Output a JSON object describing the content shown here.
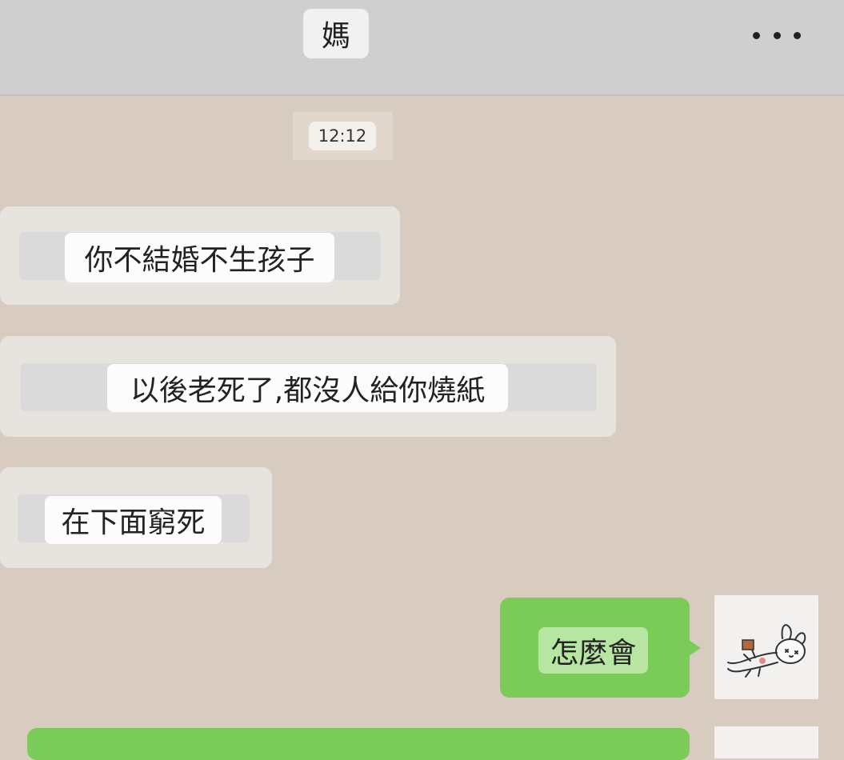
{
  "header": {
    "title": "媽",
    "more_icon": "more-dots-icon"
  },
  "timestamp": "12:12",
  "messages": [
    {
      "side": "incoming",
      "text": "你不結婚不生孩子"
    },
    {
      "side": "incoming",
      "text": "以後老死了,都沒人給你燒紙"
    },
    {
      "side": "incoming",
      "text": "在下面窮死"
    },
    {
      "side": "outgoing",
      "text": "怎麼會"
    }
  ],
  "colors": {
    "chat_background": "#d8ccc0",
    "outgoing_bubble": "#7acb57",
    "incoming_bubble": "#e7e3df"
  },
  "avatar": "rabbit-avatar-icon"
}
